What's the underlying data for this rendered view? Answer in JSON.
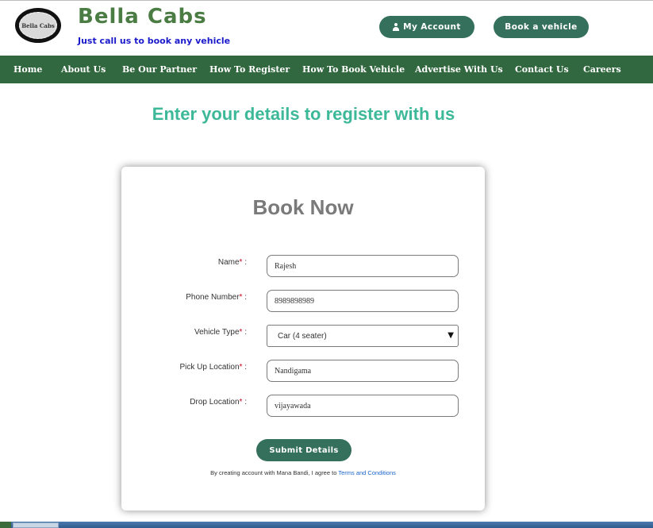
{
  "header": {
    "logo_text": "Bella Cabs",
    "brand": "Bella Cabs",
    "tagline": "Just call us to book any vehicle",
    "my_account_label": "My Account",
    "my_account_icon": "user-icon",
    "book_vehicle_label": "Book a vehicle"
  },
  "nav": {
    "items": [
      "Home",
      "About Us",
      "Be Our Partner",
      "How To Register",
      "How To Book Vehicle",
      "Advertise With Us",
      "Contact Us",
      "Careers"
    ]
  },
  "page": {
    "heading": "Enter your details to register with us"
  },
  "form": {
    "title": "Book Now",
    "required_mark": "*",
    "fields": [
      {
        "label": "Name",
        "value": "Rajesh"
      },
      {
        "label": "Phone Number",
        "value": "8989898989"
      },
      {
        "label": "Vehicle Type",
        "value": "Car (4 seater)"
      },
      {
        "label": "Pick Up Location",
        "value": "Nandigama"
      },
      {
        "label": "Drop Location",
        "value": "vijayawada"
      }
    ],
    "submit_label": "Submit Details",
    "terms_text": "By creating account with Mana Bandi, I agree to ",
    "terms_link": "Terms and Conditions"
  },
  "colors": {
    "brand_green": "#4a7c43",
    "nav_bg": "#32683f",
    "button_bg": "#35705c",
    "heading_teal": "#3db898",
    "tagline_blue": "#1a1acc",
    "link_blue": "#1a63c9",
    "required_red": "#d0021b"
  }
}
